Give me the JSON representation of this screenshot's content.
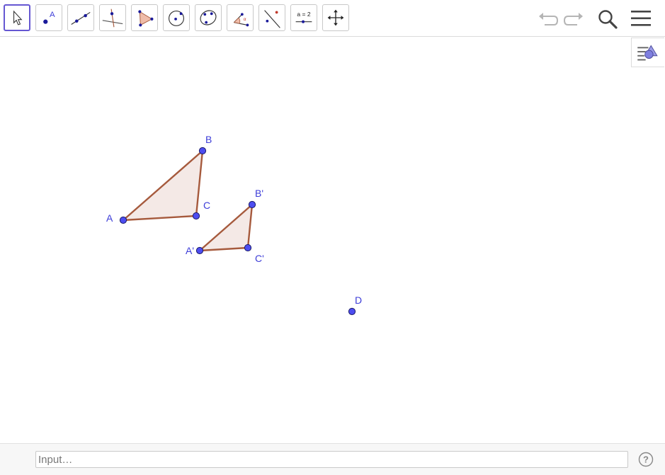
{
  "toolbar": {
    "tools": [
      {
        "name": "move-tool",
        "icon": "cursor-arrow-icon"
      },
      {
        "name": "point-tool",
        "icon": "point-icon"
      },
      {
        "name": "line-tool",
        "icon": "line-through-points-icon"
      },
      {
        "name": "perpendicular-line-tool",
        "icon": "perpendicular-line-icon"
      },
      {
        "name": "polygon-tool",
        "icon": "polygon-icon"
      },
      {
        "name": "circle-tool",
        "icon": "circle-center-point-icon"
      },
      {
        "name": "conic-tool",
        "icon": "ellipse-icon"
      },
      {
        "name": "angle-tool",
        "icon": "angle-icon"
      },
      {
        "name": "reflect-tool",
        "icon": "reflect-about-line-icon"
      },
      {
        "name": "slider-tool",
        "icon": "slider-icon",
        "label": "a = 2"
      },
      {
        "name": "move-graphics-view-tool",
        "icon": "move-view-icon"
      }
    ],
    "active_tool": "move-tool",
    "right_buttons": [
      "undo-icon",
      "redo-icon",
      "search-icon",
      "menu-icon"
    ]
  },
  "graphics": {
    "points": {
      "A": "A",
      "B": "B",
      "C": "C",
      "A1": "A'",
      "B1": "B'",
      "C1": "C'",
      "D": "D"
    },
    "colors": {
      "point_fill": "#4d4df0",
      "label": "#3d3dd8",
      "polygon_stroke": "#a65a3d",
      "polygon_fill": "#f4e9e6"
    }
  },
  "input_bar": {
    "placeholder": "Input…",
    "help_icon": "help-icon"
  },
  "colors": {
    "active_tool_border": "#6557d2",
    "toolbar_bg": "#ffffff",
    "input_bar_bg": "#f7f7f7"
  }
}
